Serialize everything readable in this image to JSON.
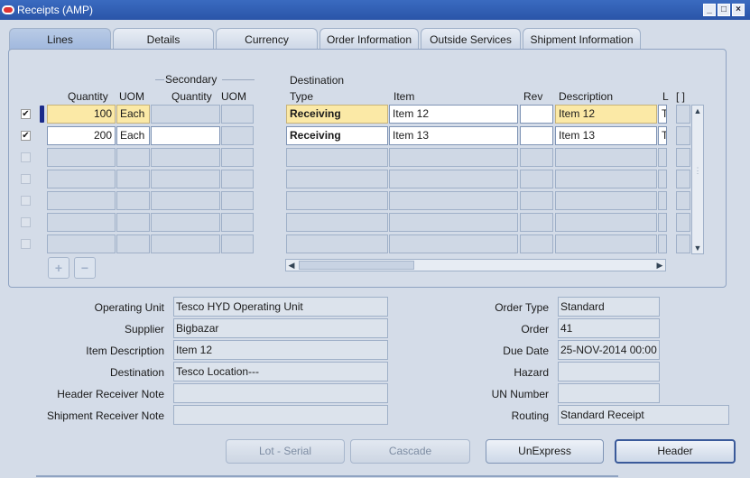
{
  "window": {
    "title": "Receipts (AMP)"
  },
  "tabs": [
    {
      "label": "Lines"
    },
    {
      "label": "Details"
    },
    {
      "label": "Currency"
    },
    {
      "label": "Order Information"
    },
    {
      "label": "Outside Services"
    },
    {
      "label": "Shipment Information"
    }
  ],
  "grid": {
    "group_secondary": "Secondary",
    "group_destination": "Destination",
    "headers": {
      "quantity": "Quantity",
      "uom": "UOM",
      "sec_quantity": "Quantity",
      "sec_uom": "UOM",
      "dest_type": "Type",
      "item": "Item",
      "rev": "Rev",
      "description": "Description",
      "l": "L",
      "folder": "[ ]"
    },
    "rows": [
      {
        "checked": "✔",
        "quantity": "100",
        "uom": "Each",
        "sec_quantity": "",
        "sec_uom": "",
        "dest_type": "Receiving",
        "item": "Item 12",
        "rev": "",
        "description": "Item 12",
        "l": "T"
      },
      {
        "checked": "✔",
        "quantity": "200",
        "uom": "Each",
        "sec_quantity": "",
        "sec_uom": "",
        "dest_type": "Receiving",
        "item": "Item 13",
        "rev": "",
        "description": "Item 13",
        "l": "T"
      }
    ]
  },
  "form": {
    "operating_unit": {
      "label": "Operating Unit",
      "value": "Tesco HYD Operating Unit"
    },
    "supplier": {
      "label": "Supplier",
      "value": "Bigbazar"
    },
    "item_description": {
      "label": "Item Description",
      "value": "Item 12"
    },
    "destination": {
      "label": "Destination",
      "value": "Tesco Location---"
    },
    "header_receiver_note": {
      "label": "Header Receiver Note",
      "value": ""
    },
    "shipment_receiver_note": {
      "label": "Shipment Receiver Note",
      "value": ""
    },
    "order_type": {
      "label": "Order Type",
      "value": "Standard"
    },
    "order": {
      "label": "Order",
      "value": "41"
    },
    "due_date": {
      "label": "Due Date",
      "value": "25-NOV-2014 00:00"
    },
    "hazard": {
      "label": "Hazard",
      "value": ""
    },
    "un_number": {
      "label": "UN Number",
      "value": ""
    },
    "routing": {
      "label": "Routing",
      "value": "Standard Receipt"
    }
  },
  "buttons": {
    "lot_serial": "Lot - Serial",
    "cascade": "Cascade",
    "unexpress": "UnExpress",
    "header": "Header",
    "add": "+",
    "remove": "−"
  },
  "icons": {
    "app": "oracle-logo-icon",
    "minimize": "minimize-icon",
    "maximize": "maximize-icon",
    "close": "close-icon"
  },
  "colors": {
    "titlebar": "#2a55a8",
    "required_field": "#fbe9a6",
    "background": "#d4dce8"
  }
}
